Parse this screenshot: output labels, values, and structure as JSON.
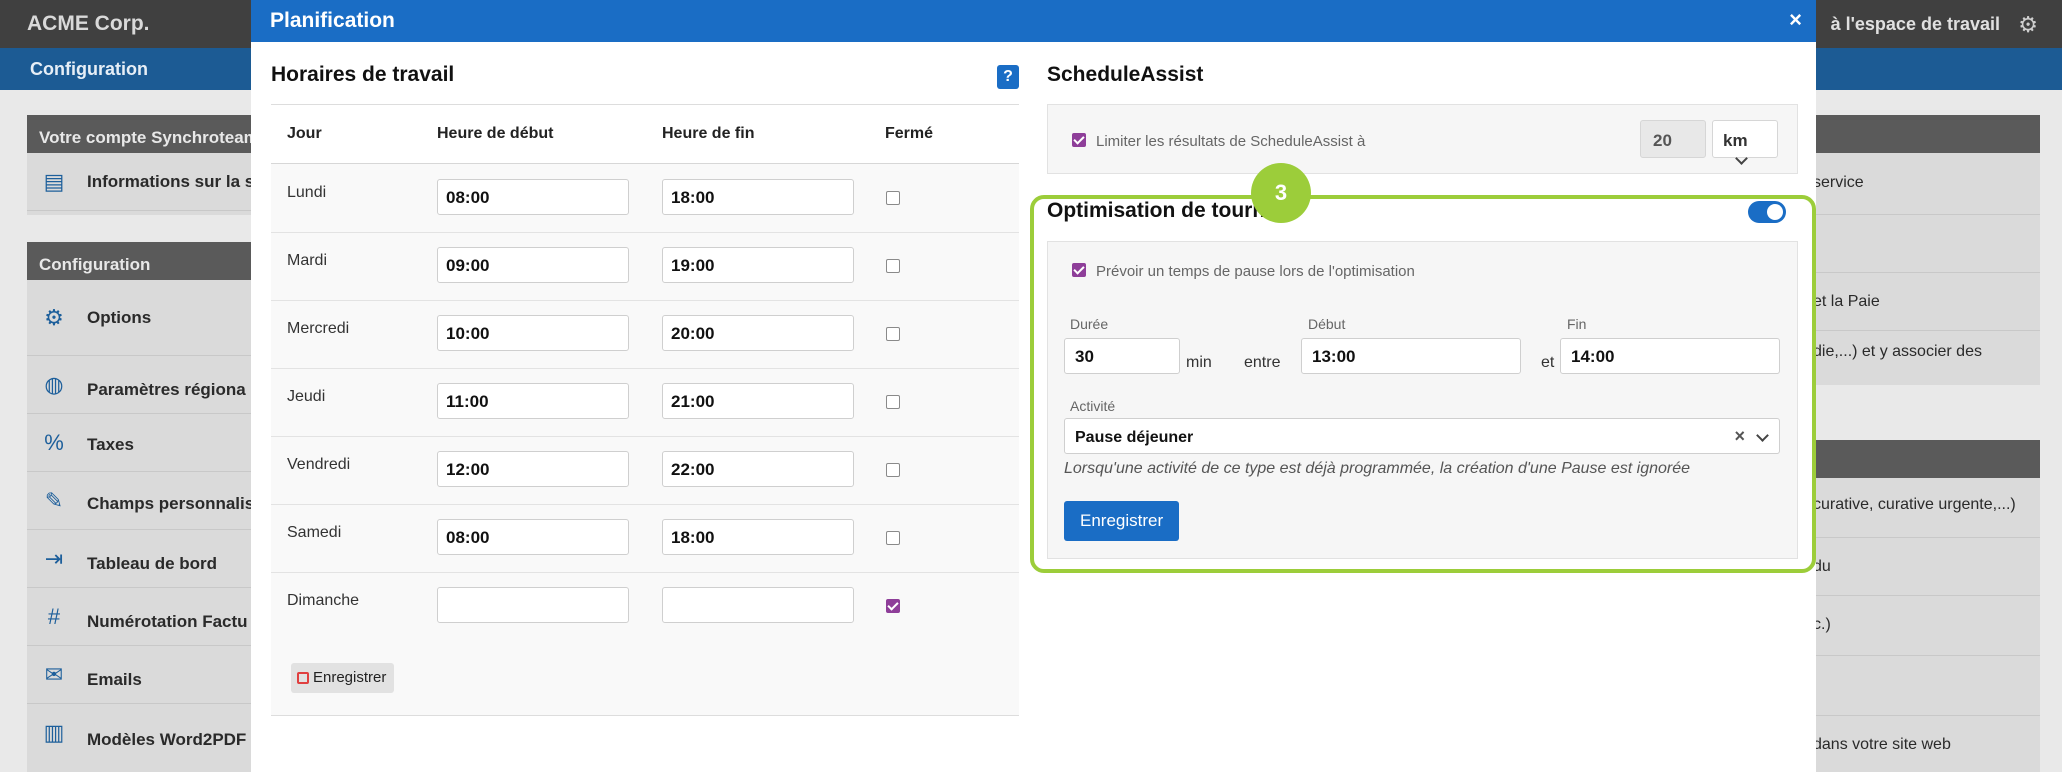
{
  "background": {
    "brand": "ACME Corp.",
    "back_link": "à l'espace de travail",
    "subnav": "Configuration",
    "account_panel": {
      "title": "Votre compte Synchroteam",
      "items": [
        {
          "label": "Informations sur la s",
          "icon": "id-card-icon"
        }
      ]
    },
    "config_panel": {
      "title": "Configuration",
      "items": [
        {
          "label": "Options",
          "icon": "gear-icon"
        },
        {
          "label": "Paramètres régiona",
          "icon": "globe-icon"
        },
        {
          "label": "Taxes",
          "icon": "percent-icon"
        },
        {
          "label": "Champs personnalis",
          "icon": "edit-icon"
        },
        {
          "label": "Tableau de bord",
          "icon": "export-icon"
        },
        {
          "label": "Numérotation Factu",
          "icon": "hash-icon"
        },
        {
          "label": "Emails",
          "icon": "mail-icon"
        },
        {
          "label": "Modèles Word2PDF",
          "icon": "pdf-icon"
        }
      ]
    },
    "right_items": [
      "service",
      "et la Paie",
      "die,...) et y associer des",
      "curative, curative urgente,...)",
      "du",
      "c.)",
      "dans votre site web"
    ]
  },
  "modal": {
    "title": "Planification",
    "close": "×",
    "schedule": {
      "title": "Horaires de travail",
      "help": "?",
      "columns": [
        "Jour",
        "Heure de début",
        "Heure de fin",
        "Fermé"
      ],
      "rows": [
        {
          "day": "Lundi",
          "start": "08:00",
          "end": "18:00",
          "closed": false
        },
        {
          "day": "Mardi",
          "start": "09:00",
          "end": "19:00",
          "closed": false
        },
        {
          "day": "Mercredi",
          "start": "10:00",
          "end": "20:00",
          "closed": false
        },
        {
          "day": "Jeudi",
          "start": "11:00",
          "end": "21:00",
          "closed": false
        },
        {
          "day": "Vendredi",
          "start": "12:00",
          "end": "22:00",
          "closed": false
        },
        {
          "day": "Samedi",
          "start": "08:00",
          "end": "18:00",
          "closed": false
        },
        {
          "day": "Dimanche",
          "start": "",
          "end": "",
          "closed": true
        }
      ],
      "save_label": "Enregistrer"
    },
    "schedule_assist": {
      "title": "ScheduleAssist",
      "limit_label": "Limiter les résultats de ScheduleAssist à",
      "limit_checked": true,
      "limit_value": "20",
      "unit": "km"
    },
    "optimisation": {
      "title": "Optimisation de tournée",
      "badge": "3",
      "enabled": true,
      "pause_label": "Prévoir un temps de pause lors de l'optimisation",
      "pause_checked": true,
      "duration_label": "Durée",
      "duration_value": "30",
      "duration_unit": "min",
      "between": "entre",
      "start_label": "Début",
      "start_value": "13:00",
      "and": "et",
      "end_label": "Fin",
      "end_value": "14:00",
      "activity_label": "Activité",
      "activity_value": "Pause déjeuner",
      "activity_clear": "×",
      "note": "Lorsqu'une activité de ce type est déjà programmée, la création d'une Pause est ignorée",
      "save_label": "Enregistrer"
    }
  }
}
